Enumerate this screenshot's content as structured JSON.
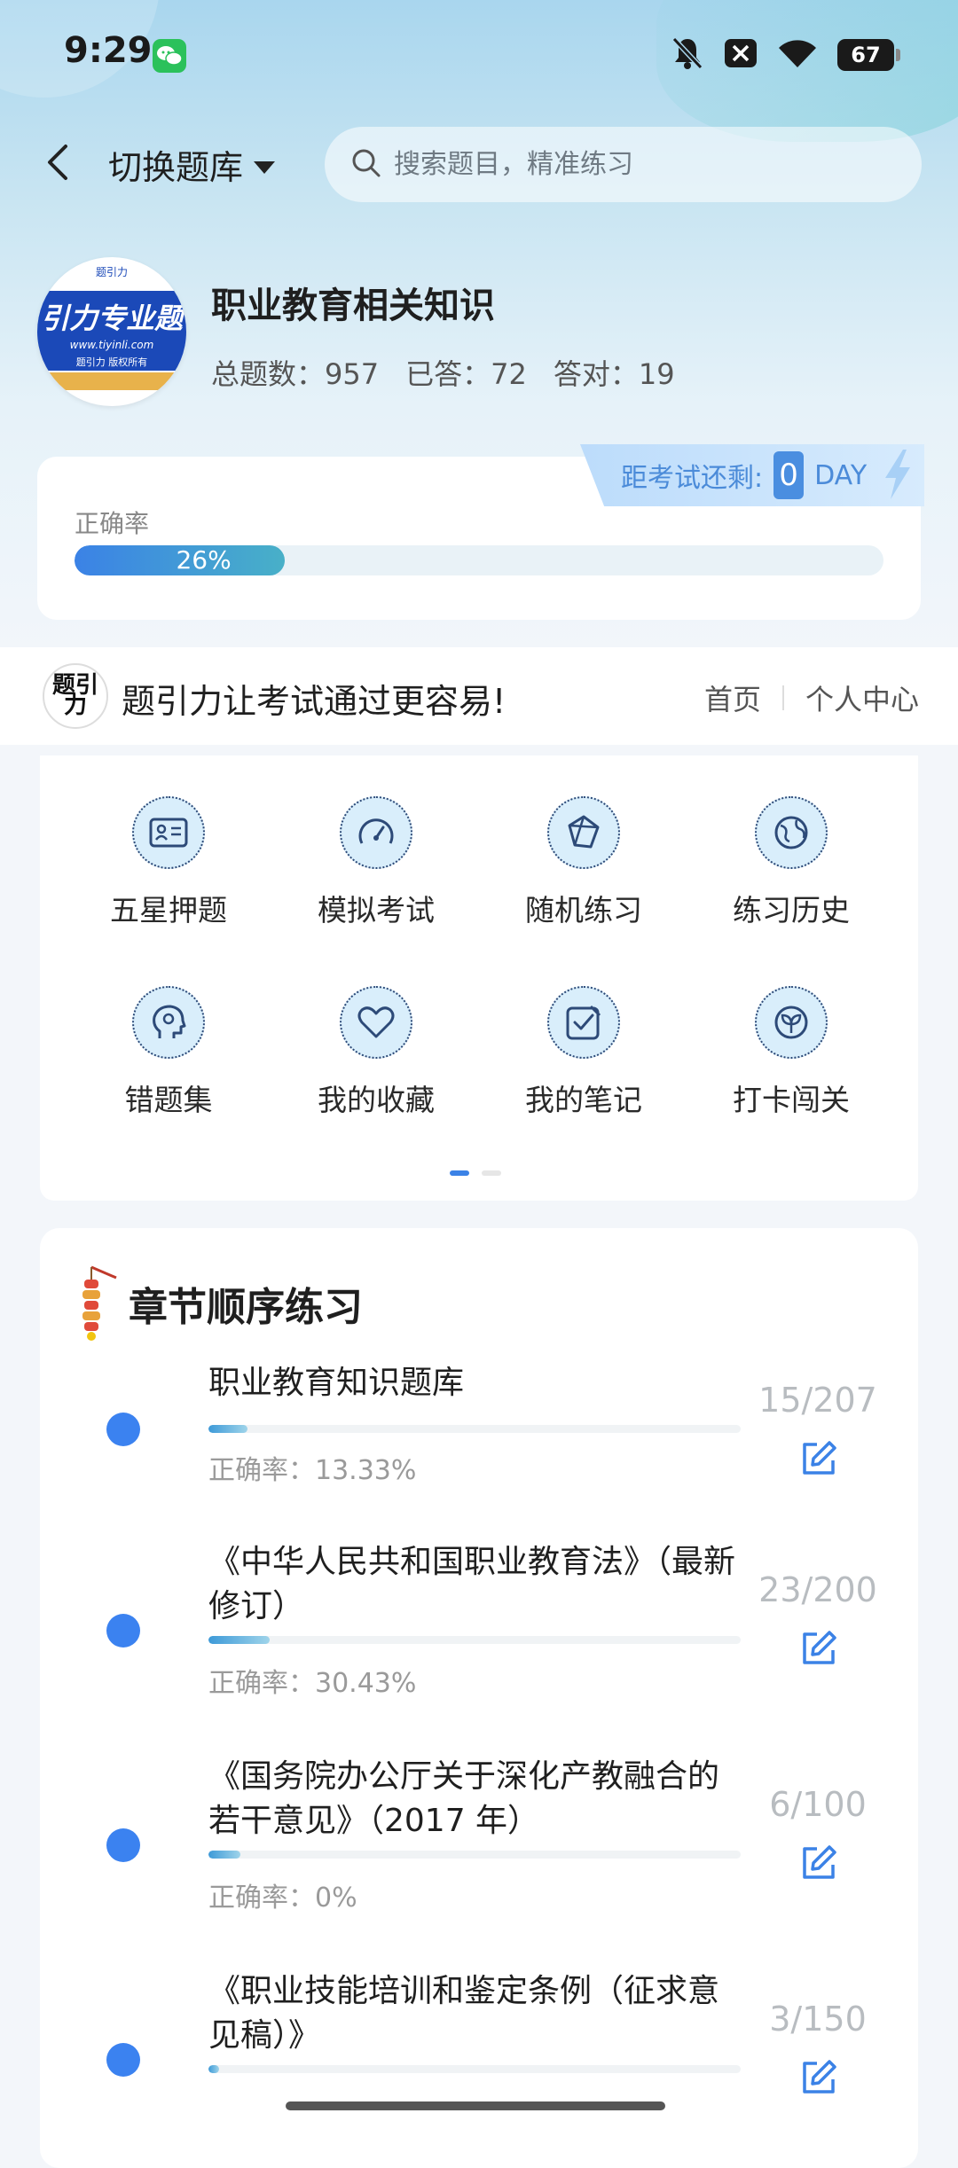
{
  "status_bar": {
    "time": "9:29",
    "battery": "67"
  },
  "header": {
    "switch_label": "切换题库",
    "search_placeholder": "搜索题目，精准练习"
  },
  "book": {
    "logo_top": "题引力",
    "logo_text": "引力专业题",
    "logo_url": "www.tiyinli.com",
    "logo_copy": "题引力 版权所有",
    "title": "职业教育相关知识",
    "total": "总题数：957",
    "answered": "已答：72",
    "correct": "答对：19"
  },
  "accuracy": {
    "countdown_label": "距考试还剩:",
    "countdown_days": "0",
    "countdown_unit": "DAY",
    "label": "正确率",
    "value": "26%",
    "fraction": 0.26
  },
  "promo": {
    "logo_text": "题引力",
    "slogan": "题引力让考试通过更容易!",
    "link_home": "首页",
    "link_profile": "个人中心"
  },
  "functions": [
    {
      "label": "五星押题",
      "icon": "id-card-icon"
    },
    {
      "label": "模拟考试",
      "icon": "speedometer-icon"
    },
    {
      "label": "随机练习",
      "icon": "shuffle-icon"
    },
    {
      "label": "练习历史",
      "icon": "globe-icon"
    },
    {
      "label": "错题集",
      "icon": "head-icon"
    },
    {
      "label": "我的收藏",
      "icon": "heart-icon"
    },
    {
      "label": "我的笔记",
      "icon": "note-check-icon"
    },
    {
      "label": "打卡闯关",
      "icon": "sprout-icon"
    }
  ],
  "chapters": {
    "title": "章节顺序练习",
    "items": [
      {
        "name": "职业教育知识题库",
        "accuracy": "正确率：13.33%",
        "count": "15/207",
        "progress": 0.0725
      },
      {
        "name": "《中华人民共和国职业教育法》（最新修订）",
        "accuracy": "正确率：30.43%",
        "count": "23/200",
        "progress": 0.115
      },
      {
        "name": "《国务院办公厅关于深化产教融合的若干意见》（2017 年）",
        "accuracy": "正确率：0%",
        "count": "6/100",
        "progress": 0.06
      },
      {
        "name": "《职业技能培训和鉴定条例（征求意见稿）》",
        "accuracy": "",
        "count": "3/150",
        "progress": 0.02
      }
    ]
  },
  "colors": {
    "accent": "#3b82e6",
    "dot": "#3b82f0",
    "count_gray": "#b8bcc0"
  }
}
